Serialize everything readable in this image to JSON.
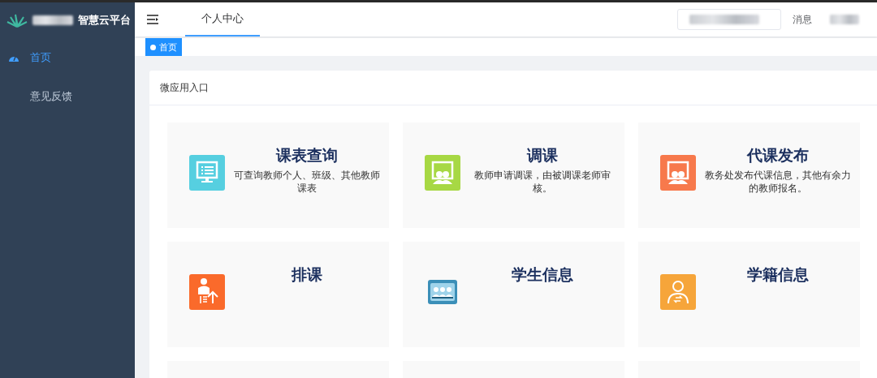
{
  "sidebar": {
    "logo_text": "智慧云平台",
    "items": [
      {
        "label": "首页",
        "selected": true
      },
      {
        "label": "意见反馈",
        "selected": false
      }
    ]
  },
  "header": {
    "tabs": [
      {
        "label": "个人中心",
        "selected": true
      }
    ],
    "messages": "消息"
  },
  "tags": [
    {
      "label": "首页",
      "selected": true
    }
  ],
  "panel": {
    "title": "微应用入口",
    "tiles": [
      {
        "kind": "app",
        "title": "课表查询",
        "description": "可查询教师个人、班级、其他教师课表",
        "color": "#56cfe0"
      },
      {
        "kind": "app",
        "title": "调课",
        "description": "教师申请调课，由被调课老师审核。",
        "color": "#a7d844"
      },
      {
        "kind": "app",
        "title": "代课发布",
        "description": "教务处发布代课信息，其他有余力的教师报名。",
        "color": "#f7794c"
      },
      {
        "kind": "app",
        "title": "排课",
        "color": "#fa6a2b"
      },
      {
        "kind": "app",
        "title": "学生信息",
        "color": "#3b8fb8"
      },
      {
        "kind": "app",
        "title": "学籍信息",
        "color": "#f6a53a"
      },
      {
        "kind": "empty"
      },
      {
        "kind": "empty"
      },
      {
        "kind": "empty"
      }
    ]
  }
}
